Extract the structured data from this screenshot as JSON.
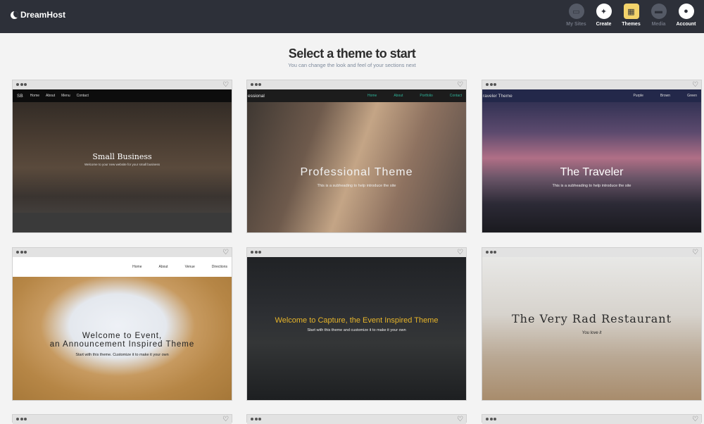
{
  "app": {
    "brand": "DreamHost"
  },
  "nav": [
    {
      "label": "My Sites",
      "icon": "sites-icon",
      "state": "dim"
    },
    {
      "label": "Create",
      "icon": "create-icon",
      "state": "on"
    },
    {
      "label": "Themes",
      "icon": "themes-icon",
      "state": "on"
    },
    {
      "label": "Media",
      "icon": "media-icon",
      "state": "dim"
    },
    {
      "label": "Account",
      "icon": "account-icon",
      "state": "on"
    }
  ],
  "heading": {
    "title": "Select a theme to start",
    "subtitle": "You can change the look and feel of your sections next"
  },
  "themes": [
    {
      "title": "Small Business",
      "subtitle": "Welcome to your new website for your small business",
      "brand": "SB",
      "links": [
        "Home",
        "About",
        "Menu",
        "Contact"
      ]
    },
    {
      "title": "Professional Theme",
      "subtitle": "This is a subheading to help introduce the site",
      "brand": "essional",
      "links": [
        "Home",
        "About",
        "Portfolio",
        "Contact"
      ]
    },
    {
      "title": "The Traveler",
      "subtitle": "This is a subheading to help introduce the site",
      "brand": "raveler Theme",
      "links": [
        "Purple",
        "Brown",
        "Green"
      ]
    },
    {
      "title_line1": "Welcome to Event,",
      "title_line2": "an Announcement Inspired Theme",
      "subtitle": "Start with this theme. Customize it to make it your own",
      "links": [
        "Home",
        "About",
        "Venue",
        "Directions"
      ]
    },
    {
      "title": "Welcome to Capture, the Event Inspired Theme",
      "subtitle": "Start with this theme and customize it to make it your own"
    },
    {
      "title": "The Very Rad Restaurant",
      "subtitle": "You love it"
    }
  ],
  "colors": {
    "topbar": "#2d3039",
    "accent_teal": "#2fb59a",
    "capture_gold": "#e7b52a"
  }
}
